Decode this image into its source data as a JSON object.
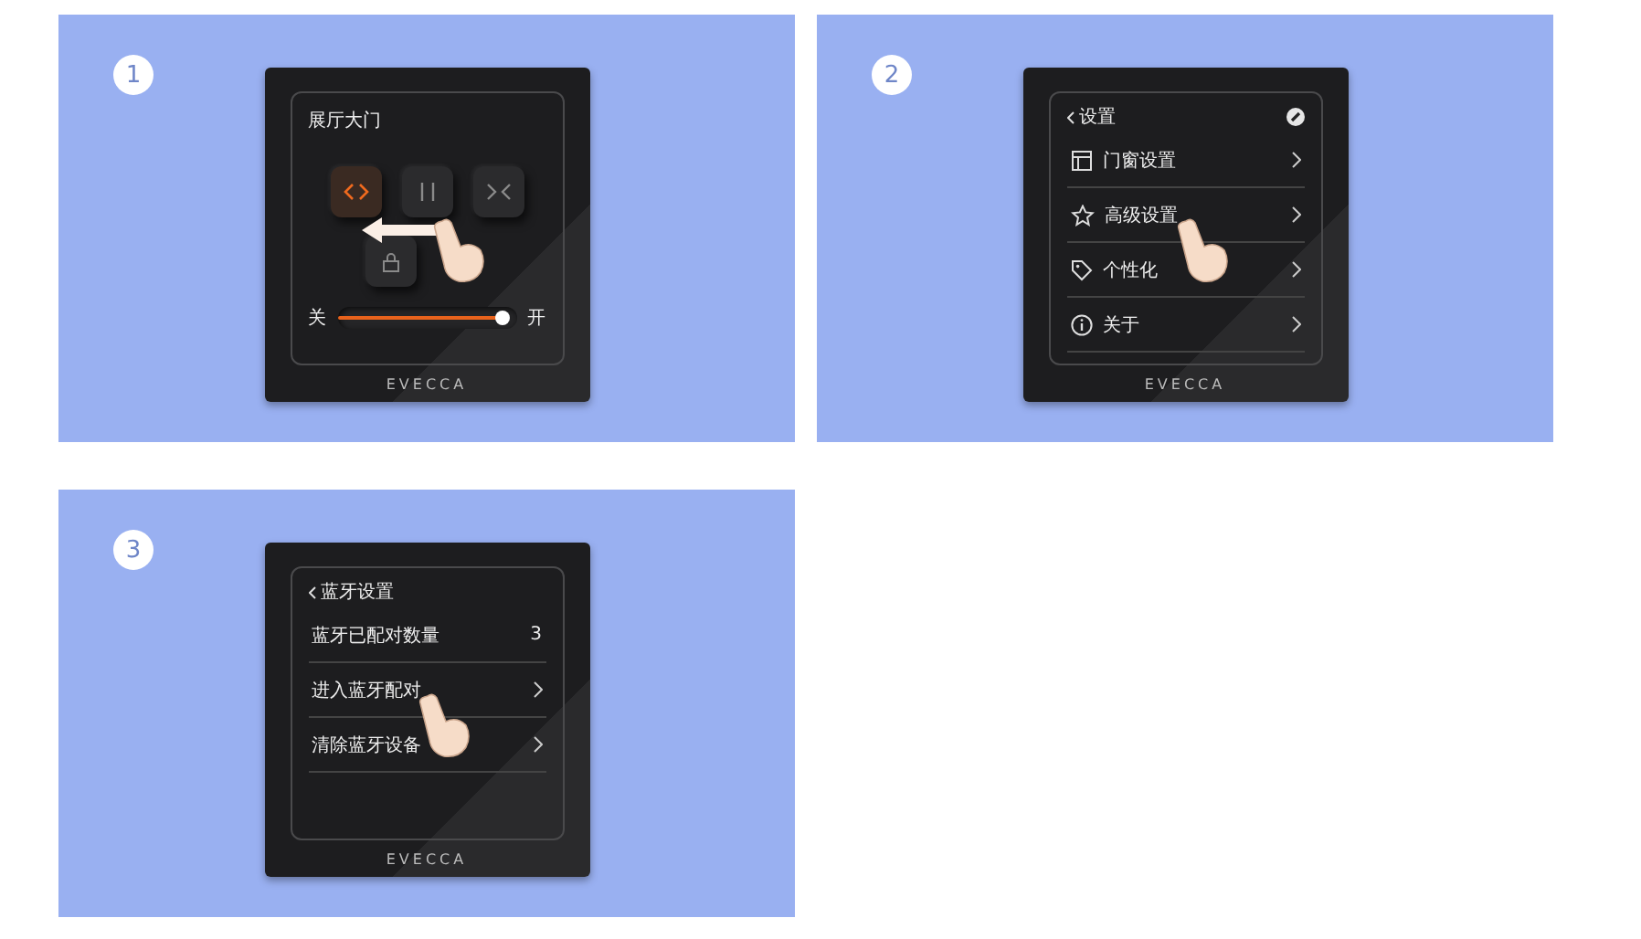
{
  "steps": [
    {
      "number": "1",
      "kind": "door_control",
      "title": "展厅大门",
      "buttons": [
        {
          "kind": "open",
          "selected": true
        },
        {
          "kind": "pause",
          "selected": false
        },
        {
          "kind": "close",
          "selected": false
        },
        {
          "kind": "lock",
          "selected": false
        }
      ],
      "slider": {
        "min_label": "关",
        "max_label": "开",
        "level": 0.92
      },
      "brand": "EVECCA"
    },
    {
      "number": "2",
      "kind": "settings_menu",
      "back_label": "设置",
      "items": [
        {
          "kind": "link",
          "label": "门窗设置"
        },
        {
          "kind": "link",
          "label": "高级设置"
        },
        {
          "kind": "link",
          "label": "个性化"
        },
        {
          "kind": "link",
          "label": "关于"
        }
      ],
      "brand": "EVECCA"
    },
    {
      "number": "3",
      "kind": "list_menu",
      "back_label": "蓝牙设置",
      "items": [
        {
          "kind": "value",
          "label": "蓝牙已配对数量",
          "value": "3"
        },
        {
          "kind": "link",
          "label": "进入蓝牙配对"
        },
        {
          "kind": "link",
          "label": "清除蓝牙设备"
        }
      ],
      "brand": "EVECCA"
    }
  ]
}
